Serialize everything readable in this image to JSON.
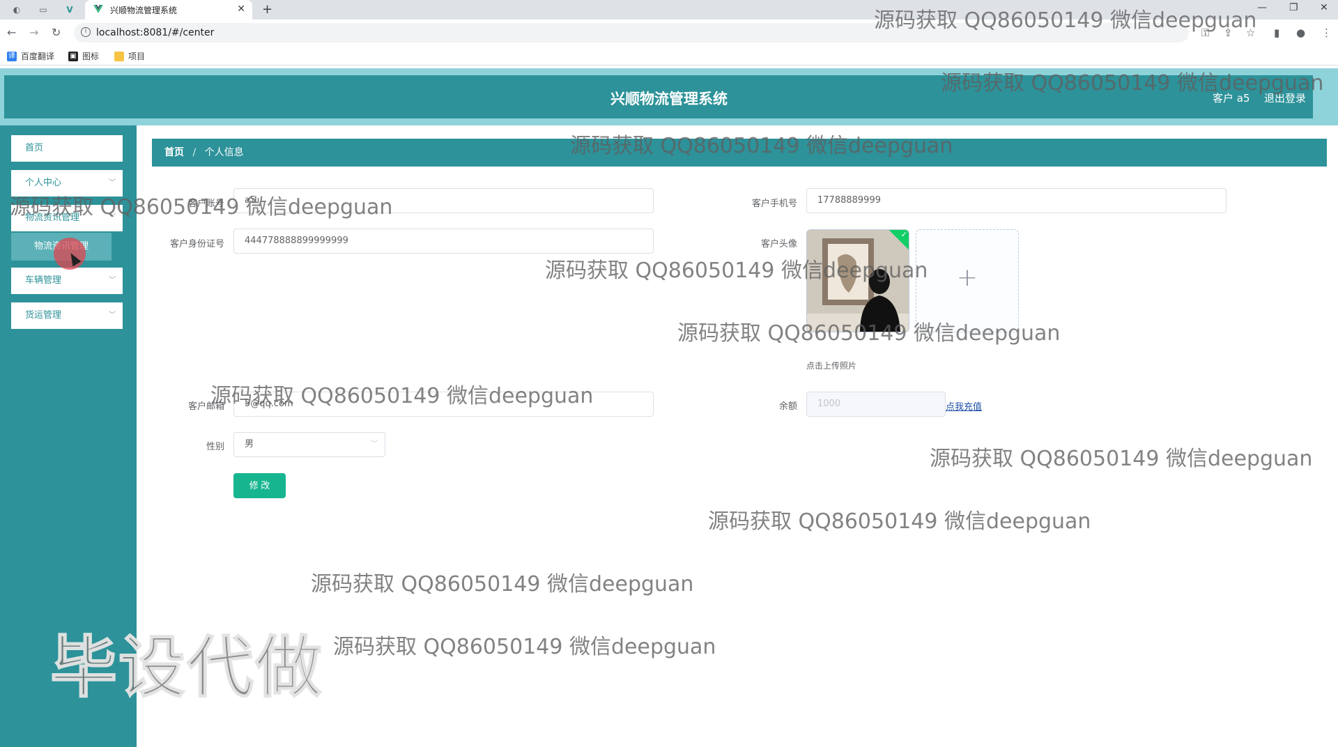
{
  "browser": {
    "tab_title": "兴顺物流管理系统",
    "tab_close": "✕",
    "new_tab": "+",
    "url": "localhost:8081/#/center",
    "bookmarks": [
      "百度翻译",
      "图标",
      "项目"
    ]
  },
  "header": {
    "title": "兴顺物流管理系统",
    "user": "客户 a5",
    "logout": "退出登录"
  },
  "sidebar": {
    "items": [
      {
        "label": "首页"
      },
      {
        "label": "个人中心"
      },
      {
        "label": "物流资讯管理"
      },
      {
        "label": "物流资讯管理"
      },
      {
        "label": "车辆管理"
      },
      {
        "label": "货运管理"
      }
    ]
  },
  "breadcrumb": {
    "home": "首页",
    "separator": "/",
    "current": "个人信息"
  },
  "form": {
    "account_label": "客户账号",
    "account_value": "a5",
    "phone_label": "客户手机号",
    "phone_value": "17788889999",
    "idcard_label": "客户身份证号",
    "idcard_value": "444778888899999999",
    "avatar_label": "客户头像",
    "upload_tip": "点击上传照片",
    "email_label": "客户邮箱",
    "email_value": "5@qq.com",
    "balance_label": "余额",
    "balance_value": "1000",
    "recharge_link": "点我充值",
    "gender_label": "性别",
    "gender_value": "男",
    "submit_label": "修 改"
  },
  "watermarks": {
    "text": "源码获取 QQ86050149 微信deepguan",
    "big": "毕设代做"
  },
  "colors": {
    "primary": "#2d9299",
    "header_band": "#8ed3da",
    "button": "#17b58f",
    "link": "#1e4fa7"
  }
}
